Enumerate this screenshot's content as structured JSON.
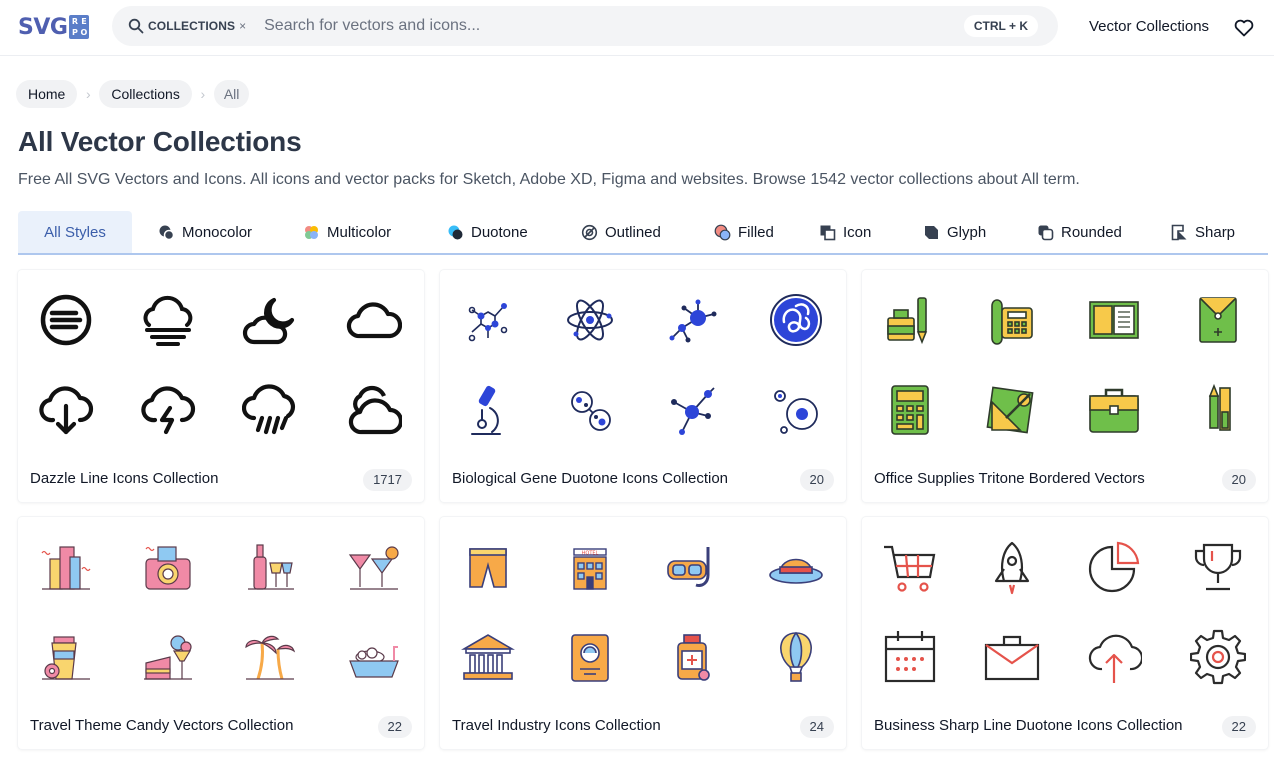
{
  "header": {
    "logo_text": "SVG",
    "logo_badge": [
      "R",
      "E",
      "P",
      "O"
    ],
    "search_chip": "COLLECTIONS",
    "search_chip_close": "×",
    "search_placeholder": "Search for vectors and icons...",
    "shortcut": "CTRL + K",
    "nav_link": "Vector Collections"
  },
  "breadcrumb": [
    {
      "label": "Home"
    },
    {
      "label": "Collections"
    },
    {
      "label": "All"
    }
  ],
  "breadcrumb_sep": "›",
  "page": {
    "title": "All Vector Collections",
    "description": "Free All SVG Vectors and Icons. All icons and vector packs for Sketch, Adobe XD, Figma and websites. Browse 1542 vector collections about All term."
  },
  "tabs": [
    {
      "label": "All Styles",
      "icon": "none",
      "active": true
    },
    {
      "label": "Monocolor",
      "icon": "monocolor-icon"
    },
    {
      "label": "Multicolor",
      "icon": "multicolor-icon"
    },
    {
      "label": "Duotone",
      "icon": "duotone-icon"
    },
    {
      "label": "Outlined",
      "icon": "outlined-icon"
    },
    {
      "label": "Filled",
      "icon": "filled-icon"
    },
    {
      "label": "Icon",
      "icon": "icon-style-icon"
    },
    {
      "label": "Glyph",
      "icon": "glyph-icon"
    },
    {
      "label": "Rounded",
      "icon": "rounded-icon"
    },
    {
      "label": "Sharp",
      "icon": "sharp-icon"
    }
  ],
  "collections": [
    {
      "title": "Dazzle Line Icons Collection",
      "count": "1717",
      "icons": [
        "wind-circle-icon",
        "fog-icon",
        "cloud-moon-icon",
        "cloud-icon",
        "cloud-download-icon",
        "thunder-cloud-icon",
        "rain-cloud-icon",
        "double-cloud-icon"
      ]
    },
    {
      "title": "Biological Gene Duotone Icons Collection",
      "count": "20",
      "icons": [
        "molecule-chain-icon",
        "atom-icon",
        "molecule-network-icon",
        "dna-blob-icon",
        "microscope-icon",
        "cells-icon",
        "molecule-cluster-icon",
        "cell-division-icon"
      ]
    },
    {
      "title": "Office Supplies Tritone Bordered Vectors",
      "count": "20",
      "icons": [
        "ink-pen-icon",
        "telephone-icon",
        "folder-document-icon",
        "envelope-pocket-icon",
        "calculator-icon",
        "drafting-tools-icon",
        "briefcase-icon",
        "cutter-pencil-icon"
      ]
    },
    {
      "title": "Travel Theme Candy Vectors Collection",
      "count": "22",
      "icons": [
        "city-buildings-icon",
        "camera-icon",
        "wine-glasses-icon",
        "cocktails-icon",
        "coffee-cup-icon",
        "ice-cream-cake-icon",
        "palm-trees-icon",
        "bathtub-icon"
      ]
    },
    {
      "title": "Travel Industry Icons Collection",
      "count": "24",
      "icons": [
        "shorts-icon",
        "hotel-icon",
        "snorkel-mask-icon",
        "sun-hat-icon",
        "museum-icon",
        "passport-icon",
        "medicine-bottle-icon",
        "hot-air-balloon-icon"
      ]
    },
    {
      "title": "Business Sharp Line Duotone Icons Collection",
      "count": "22",
      "icons": [
        "shopping-cart-icon",
        "rocket-icon",
        "pie-chart-icon",
        "trophy-icon",
        "calendar-icon",
        "briefcase-outline-icon",
        "cloud-upload-icon",
        "gear-icon"
      ]
    }
  ],
  "colors": {
    "accent": "#3b5eaa",
    "tab_active_bg": "#eaf1fb",
    "bio_blue": "#2d45d8",
    "office_green": "#6fbf4a",
    "candy_pink": "#f08aa6",
    "travel_orange": "#f7a948",
    "business_red": "#e5534b"
  }
}
